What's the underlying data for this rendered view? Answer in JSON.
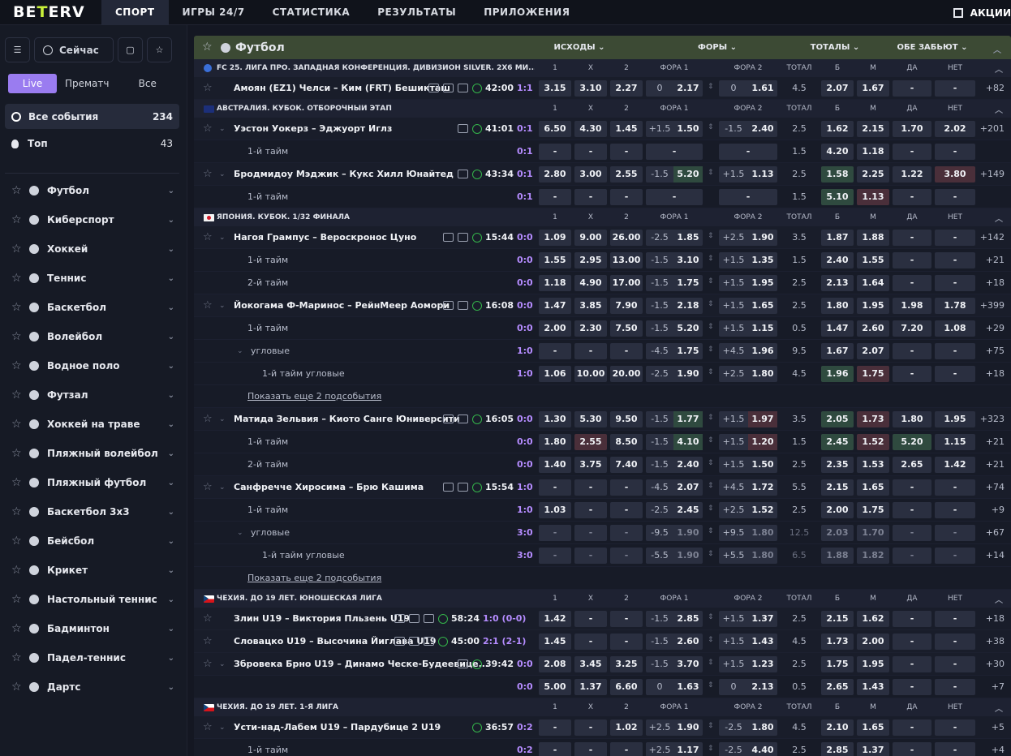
{
  "brand": {
    "logo_left": "BE",
    "logo_plus": "T",
    "logo_right": "ERV"
  },
  "nav": [
    "СПОРТ",
    "ИГРЫ 24/7",
    "СТАТИСТИКА",
    "РЕЗУЛЬТАТЫ",
    "ПРИЛОЖЕНИЯ"
  ],
  "promo": "АКЦИИ",
  "sidebar": {
    "now": "Сейчас",
    "tabs": [
      "Live",
      "Прематч",
      "Все"
    ],
    "all_events": {
      "label": "Все события",
      "count": "234"
    },
    "top": {
      "label": "Топ",
      "count": "43"
    },
    "sports": [
      "Футбол",
      "Киберспорт",
      "Хоккей",
      "Теннис",
      "Баскетбол",
      "Волейбол",
      "Водное поло",
      "Футзал",
      "Хоккей на траве",
      "Пляжный волейбол",
      "Пляжный футбол",
      "Баскетбол 3x3",
      "Бейсбол",
      "Крикет",
      "Настольный теннис",
      "Бадминтон",
      "Падел-теннис",
      "Дартс"
    ]
  },
  "header": {
    "sport": "Футбол",
    "groups": [
      "ИСХОДЫ",
      "ФОРЫ",
      "ТОТАЛЫ",
      "ОБЕ ЗАБЬЮТ"
    ]
  },
  "cols": [
    "1",
    "X",
    "2",
    "ФОРА 1",
    "ФОРА 2",
    "ТОТАЛ",
    "Б",
    "М",
    "ДА",
    "НЕТ"
  ],
  "show_more": "Показать еще 2 подсобытия",
  "rows": [
    {
      "t": "league",
      "name": "FC 25. ЛИГА ПРО. ЗАПАДНАЯ КОНФЕРЕНЦИЯ. ДИВИЗИОН SILVER. 2Х6 МИ...",
      "flag": "cup"
    },
    {
      "t": "ev",
      "name": "Амоян (EZ1) Челси – Ким (FRT) Бешикташ",
      "time": "42:00",
      "score": "1:1",
      "o": [
        "3.15",
        "3.10",
        "2.27"
      ],
      "f1": [
        "0",
        "2.17"
      ],
      "f2": [
        "0",
        "1.61"
      ],
      "tot": "4.5",
      "tt": [
        "2.07",
        "1.67"
      ],
      "bt": [
        "-",
        "-"
      ],
      "more": "+82",
      "icons": 3,
      "noChev": true
    },
    {
      "t": "league",
      "name": "АВСТРАЛИЯ. КУБОК. ОТБОРОЧНЫЙ ЭТАП",
      "flag": "au"
    },
    {
      "t": "ev",
      "name": "Уэстон Уокерз – Эджуорт Иглз",
      "time": "41:01",
      "score": "0:1",
      "o": [
        "6.50",
        "4.30",
        "1.45"
      ],
      "f1": [
        "+1.5",
        "1.50"
      ],
      "f2": [
        "-1.5",
        "2.40"
      ],
      "tot": "2.5",
      "tt": [
        "1.62",
        "2.15"
      ],
      "bt": [
        "1.70",
        "2.02"
      ],
      "more": "+201",
      "icons": 1
    },
    {
      "t": "sub",
      "name": "1-й тайм",
      "score": "0:1",
      "o": [
        "-",
        "-",
        "-"
      ],
      "f1": [
        "",
        "-"
      ],
      "f2": [
        "",
        "-"
      ],
      "tot": "1.5",
      "tt": [
        "4.20",
        "1.18"
      ],
      "bt": [
        "-",
        "-"
      ],
      "more": "",
      "wide": true
    },
    {
      "t": "ev",
      "name": "Бродмидоу Мэджик – Кукс Хилл Юнайтед",
      "time": "43:34",
      "score": "0:1",
      "o": [
        "2.80",
        "3.00",
        "2.55"
      ],
      "f1": [
        "-1.5",
        "5.20"
      ],
      "f2": [
        "+1.5",
        "1.13"
      ],
      "tot": "2.5",
      "tt": [
        "1.58",
        "2.25"
      ],
      "bt": [
        "1.22",
        "3.80"
      ],
      "more": "+149",
      "icons": 1,
      "hl": {
        "f1": "up",
        "tt0": "up",
        "bt1": "down"
      }
    },
    {
      "t": "sub",
      "name": "1-й тайм",
      "score": "0:1",
      "o": [
        "-",
        "-",
        "-"
      ],
      "f1": [
        "",
        "-"
      ],
      "f2": [
        "",
        "-"
      ],
      "tot": "1.5",
      "tt": [
        "5.10",
        "1.13"
      ],
      "bt": [
        "-",
        "-"
      ],
      "more": "",
      "wide": true,
      "hl": {
        "tt0": "up",
        "tt1": "down"
      }
    },
    {
      "t": "league",
      "name": "ЯПОНИЯ. КУБОК. 1/32 ФИНАЛА",
      "flag": "jp"
    },
    {
      "t": "ev",
      "name": "Нагоя Грампус – Вероскронос Цуно",
      "time": "15:44",
      "score": "0:0",
      "o": [
        "1.09",
        "9.00",
        "26.00"
      ],
      "f1": [
        "-2.5",
        "1.85"
      ],
      "f2": [
        "+2.5",
        "1.90"
      ],
      "tot": "3.5",
      "tt": [
        "1.87",
        "1.88"
      ],
      "bt": [
        "-",
        "-"
      ],
      "more": "+142",
      "icons": 2
    },
    {
      "t": "sub",
      "name": "1-й тайм",
      "score": "0:0",
      "o": [
        "1.55",
        "2.95",
        "13.00"
      ],
      "f1": [
        "-1.5",
        "3.10"
      ],
      "f2": [
        "+1.5",
        "1.35"
      ],
      "tot": "1.5",
      "tt": [
        "2.40",
        "1.55"
      ],
      "bt": [
        "-",
        "-"
      ],
      "more": "+21"
    },
    {
      "t": "sub",
      "name": "2-й тайм",
      "score": "0:0",
      "o": [
        "1.18",
        "4.90",
        "17.00"
      ],
      "f1": [
        "-1.5",
        "1.75"
      ],
      "f2": [
        "+1.5",
        "1.95"
      ],
      "tot": "2.5",
      "tt": [
        "2.13",
        "1.64"
      ],
      "bt": [
        "-",
        "-"
      ],
      "more": "+18"
    },
    {
      "t": "ev",
      "name": "Йокогама Ф-Маринос – РейнМеер Аомори",
      "time": "16:08",
      "score": "0:0",
      "o": [
        "1.47",
        "3.85",
        "7.90"
      ],
      "f1": [
        "-1.5",
        "2.18"
      ],
      "f2": [
        "+1.5",
        "1.65"
      ],
      "tot": "2.5",
      "tt": [
        "1.80",
        "1.95"
      ],
      "bt": [
        "1.98",
        "1.78"
      ],
      "more": "+399",
      "icons": 2
    },
    {
      "t": "sub",
      "name": "1-й тайм",
      "score": "0:0",
      "o": [
        "2.00",
        "2.30",
        "7.50"
      ],
      "f1": [
        "-1.5",
        "5.20"
      ],
      "f2": [
        "+1.5",
        "1.15"
      ],
      "tot": "0.5",
      "tt": [
        "1.47",
        "2.60"
      ],
      "bt": [
        "7.20",
        "1.08"
      ],
      "more": "+29"
    },
    {
      "t": "sub",
      "name": "угловые",
      "score": "1:0",
      "o": [
        "-",
        "-",
        "-"
      ],
      "f1": [
        "-4.5",
        "1.75"
      ],
      "f2": [
        "+4.5",
        "1.96"
      ],
      "tot": "9.5",
      "tt": [
        "1.67",
        "2.07"
      ],
      "bt": [
        "-",
        "-"
      ],
      "more": "+75",
      "lvl": 2
    },
    {
      "t": "sub",
      "name": "1-й тайм угловые",
      "score": "1:0",
      "o": [
        "1.06",
        "10.00",
        "20.00"
      ],
      "f1": [
        "-2.5",
        "1.90"
      ],
      "f2": [
        "+2.5",
        "1.80"
      ],
      "tot": "4.5",
      "tt": [
        "1.96",
        "1.75"
      ],
      "bt": [
        "-",
        "-"
      ],
      "more": "+18",
      "lvl": 3,
      "hl": {
        "tt0": "up",
        "tt1": "down"
      }
    },
    {
      "t": "show"
    },
    {
      "t": "ev",
      "name": "Матида Зельвия – Киото Санге Юниверсити",
      "time": "16:05",
      "score": "0:0",
      "o": [
        "1.30",
        "5.30",
        "9.50"
      ],
      "f1": [
        "-1.5",
        "1.77"
      ],
      "f2": [
        "+1.5",
        "1.97"
      ],
      "tot": "3.5",
      "tt": [
        "2.05",
        "1.73"
      ],
      "bt": [
        "1.80",
        "1.95"
      ],
      "more": "+323",
      "icons": 2,
      "hl": {
        "f1": "up",
        "f2": "down",
        "tt0": "up",
        "tt1": "down"
      }
    },
    {
      "t": "sub",
      "name": "1-й тайм",
      "score": "0:0",
      "o": [
        "1.80",
        "2.55",
        "8.50"
      ],
      "f1": [
        "-1.5",
        "4.10"
      ],
      "f2": [
        "+1.5",
        "1.20"
      ],
      "tot": "1.5",
      "tt": [
        "2.45",
        "1.52"
      ],
      "bt": [
        "5.20",
        "1.15"
      ],
      "more": "+21",
      "hl": {
        "o1": "down",
        "f1": "up",
        "f2": "down",
        "tt0": "up",
        "tt1": "down",
        "bt0": "up"
      }
    },
    {
      "t": "sub",
      "name": "2-й тайм",
      "score": "0:0",
      "o": [
        "1.40",
        "3.75",
        "7.40"
      ],
      "f1": [
        "-1.5",
        "2.40"
      ],
      "f2": [
        "+1.5",
        "1.50"
      ],
      "tot": "2.5",
      "tt": [
        "2.35",
        "1.53"
      ],
      "bt": [
        "2.65",
        "1.42"
      ],
      "more": "+21"
    },
    {
      "t": "ev",
      "name": "Санфречче Хиросима – Брю Кашима",
      "time": "15:54",
      "score": "1:0",
      "o": [
        "-",
        "-",
        "-"
      ],
      "f1": [
        "-4.5",
        "2.07"
      ],
      "f2": [
        "+4.5",
        "1.72"
      ],
      "tot": "5.5",
      "tt": [
        "2.15",
        "1.65"
      ],
      "bt": [
        "-",
        "-"
      ],
      "more": "+74",
      "icons": 2
    },
    {
      "t": "sub",
      "name": "1-й тайм",
      "score": "1:0",
      "o": [
        "1.03",
        "-",
        "-"
      ],
      "f1": [
        "-2.5",
        "2.45"
      ],
      "f2": [
        "+2.5",
        "1.52"
      ],
      "tot": "2.5",
      "tt": [
        "2.00",
        "1.75"
      ],
      "bt": [
        "-",
        "-"
      ],
      "more": "+9"
    },
    {
      "t": "sub",
      "name": "угловые",
      "score": "3:0",
      "o": [
        "-",
        "-",
        "-"
      ],
      "f1": [
        "-9.5",
        "1.90"
      ],
      "f2": [
        "+9.5",
        "1.80"
      ],
      "tot": "12.5",
      "tt": [
        "2.03",
        "1.70"
      ],
      "bt": [
        "-",
        "-"
      ],
      "more": "+67",
      "lvl": 2,
      "mute": true
    },
    {
      "t": "sub",
      "name": "1-й тайм угловые",
      "score": "3:0",
      "o": [
        "-",
        "-",
        "-"
      ],
      "f1": [
        "-5.5",
        "1.90"
      ],
      "f2": [
        "+5.5",
        "1.80"
      ],
      "tot": "6.5",
      "tt": [
        "1.88",
        "1.82"
      ],
      "bt": [
        "-",
        "-"
      ],
      "more": "+14",
      "lvl": 3,
      "mute": true
    },
    {
      "t": "show"
    },
    {
      "t": "league",
      "name": "ЧЕХИЯ. ДО 19 ЛЕТ. ЮНОШЕСКАЯ ЛИГА",
      "flag": "cz"
    },
    {
      "t": "ev",
      "name": "Злин U19 – Виктория Пльзень U19",
      "time": "58:24",
      "score": "1:0 (0-0)",
      "o": [
        "1.42",
        "-",
        "-"
      ],
      "f1": [
        "-1.5",
        "2.85"
      ],
      "f2": [
        "+1.5",
        "1.37"
      ],
      "tot": "2.5",
      "tt": [
        "2.15",
        "1.62"
      ],
      "bt": [
        "-",
        "-"
      ],
      "more": "+18",
      "icons": 3,
      "noChev": true
    },
    {
      "t": "ev",
      "name": "Словацко U19 – Высочина Йиглава U19",
      "time": "45:00",
      "score": "2:1 (2-1)",
      "o": [
        "1.45",
        "-",
        "-"
      ],
      "f1": [
        "-1.5",
        "2.60"
      ],
      "f2": [
        "+1.5",
        "1.43"
      ],
      "tot": "4.5",
      "tt": [
        "1.73",
        "2.00"
      ],
      "bt": [
        "-",
        "-"
      ],
      "more": "+38",
      "icons": 3,
      "noChev": true
    },
    {
      "t": "ev",
      "name": "Збровека Брно U19 – Динамо Ческе-Будеевице...",
      "time": "39:42",
      "score": "0:0",
      "o": [
        "2.08",
        "3.45",
        "3.25"
      ],
      "f1": [
        "-1.5",
        "3.70"
      ],
      "f2": [
        "+1.5",
        "1.23"
      ],
      "tot": "2.5",
      "tt": [
        "1.75",
        "1.95"
      ],
      "bt": [
        "-",
        "-"
      ],
      "more": "+30",
      "icons": 1
    },
    {
      "t": "sub",
      "name": "",
      "score": "0:0",
      "o": [
        "5.00",
        "1.37",
        "6.60"
      ],
      "f1": [
        "0",
        "1.63"
      ],
      "f2": [
        "0",
        "2.13"
      ],
      "tot": "0.5",
      "tt": [
        "2.65",
        "1.43"
      ],
      "bt": [
        "-",
        "-"
      ],
      "more": "+7"
    },
    {
      "t": "league",
      "name": "ЧЕХИЯ. ДО 19 ЛЕТ. 1-Я ЛИГА",
      "flag": "cz"
    },
    {
      "t": "ev",
      "name": "Усти-над-Лабем U19 – Пардубице 2 U19",
      "time": "36:57",
      "score": "0:2",
      "o": [
        "-",
        "-",
        "1.02"
      ],
      "f1": [
        "+2.5",
        "1.90"
      ],
      "f2": [
        "-2.5",
        "1.80"
      ],
      "tot": "4.5",
      "tt": [
        "2.10",
        "1.65"
      ],
      "bt": [
        "-",
        "-"
      ],
      "more": "+5",
      "icons": 0
    },
    {
      "t": "sub",
      "name": "1-й тайм",
      "score": "0:2",
      "o": [
        "-",
        "-",
        "-"
      ],
      "f1": [
        "+2.5",
        "1.17"
      ],
      "f2": [
        "-2.5",
        "4.40"
      ],
      "tot": "2.5",
      "tt": [
        "2.85",
        "1.37"
      ],
      "bt": [
        "-",
        "-"
      ],
      "more": "+4"
    }
  ]
}
